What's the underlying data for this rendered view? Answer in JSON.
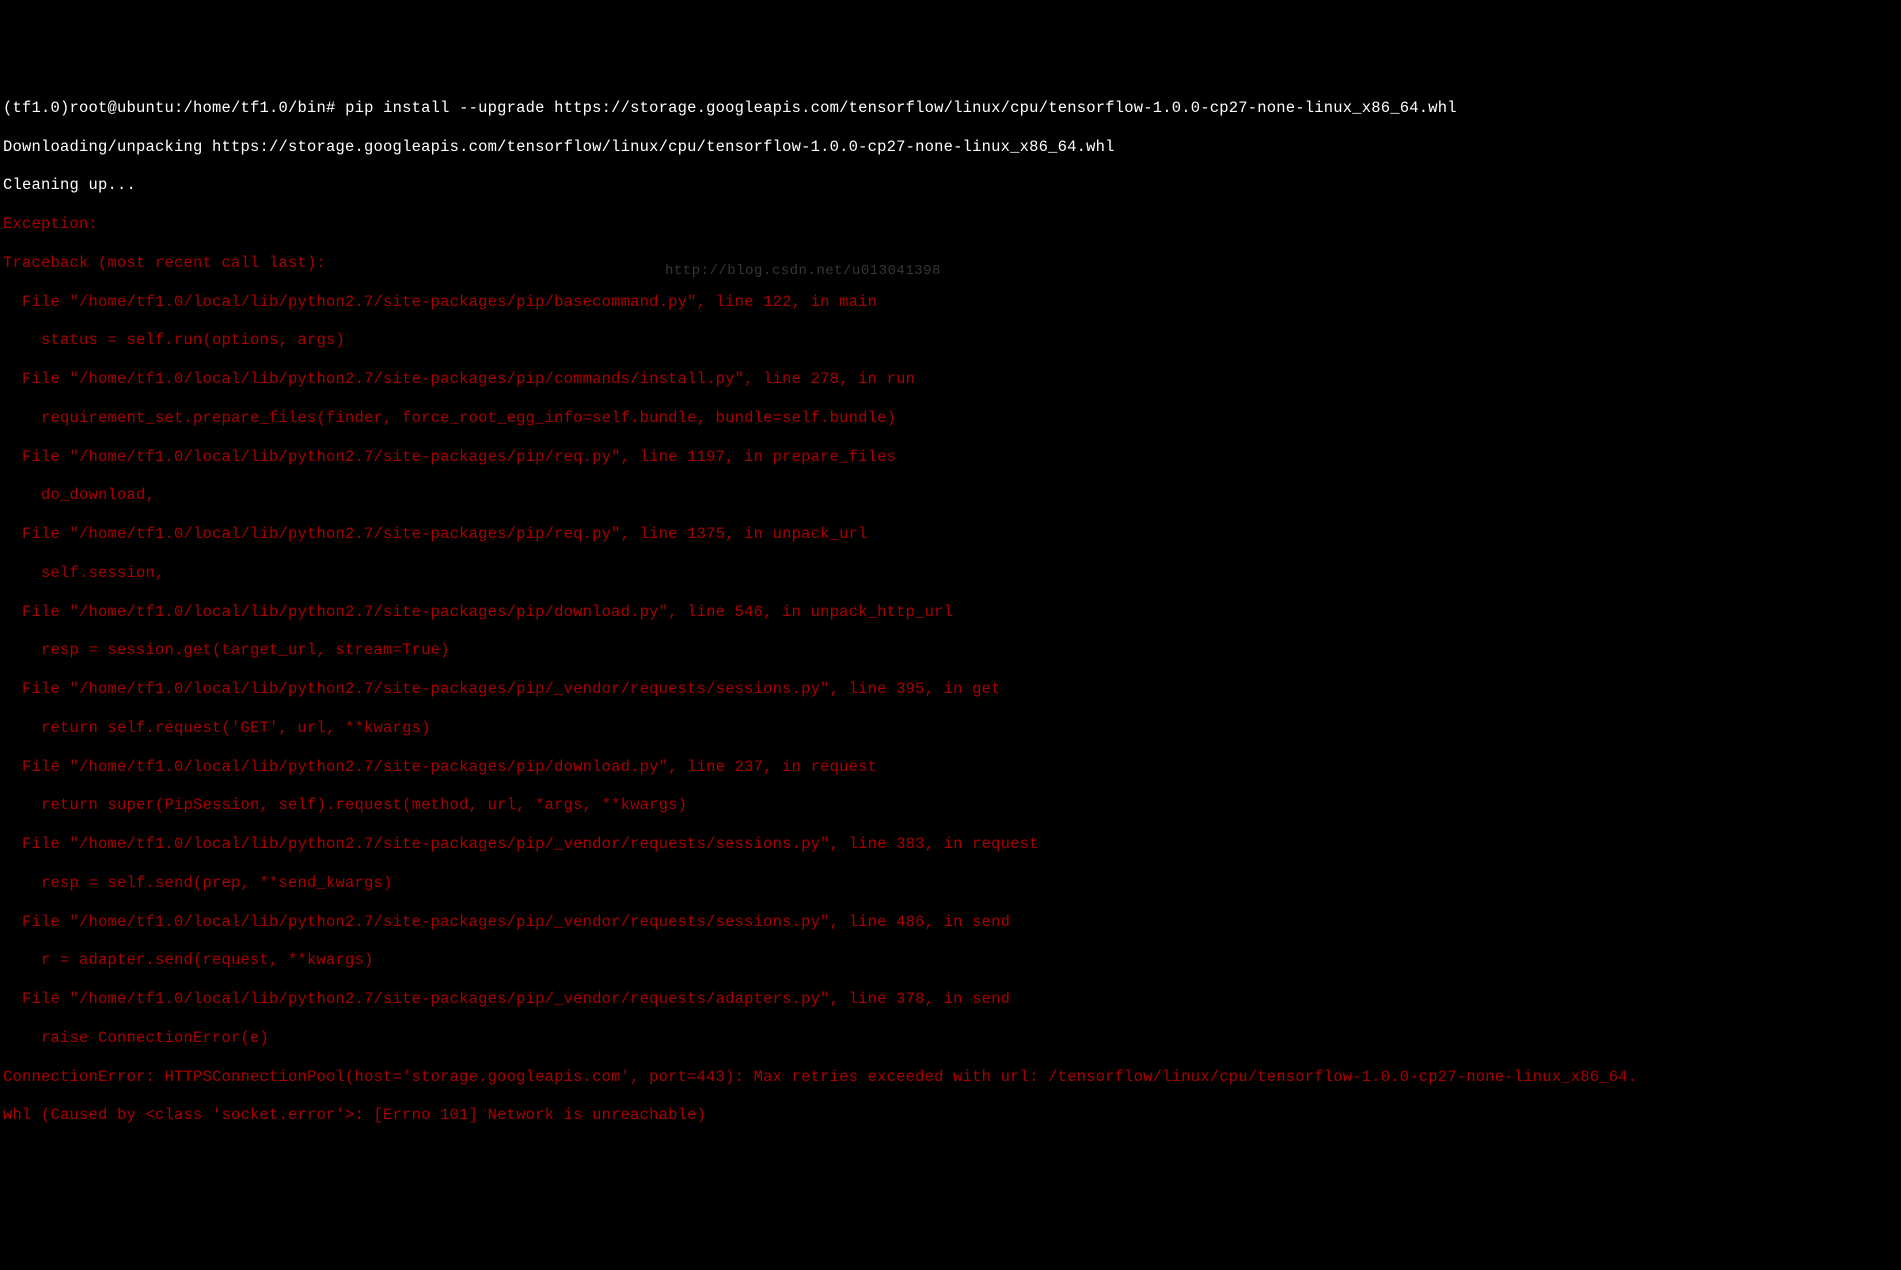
{
  "prompt": {
    "env": "(tf1.0)",
    "userhost": "root@ubuntu:/home/tf1.0/bin#",
    "command": "pip install --upgrade https://storage.googleapis.com/tensorflow/linux/cpu/tensorflow-1.0.0-cp27-none-linux_x86_64.whl"
  },
  "output": {
    "downloading": "Downloading/unpacking https://storage.googleapis.com/tensorflow/linux/cpu/tensorflow-1.0.0-cp27-none-linux_x86_64.whl",
    "cleaning": "Cleaning up..."
  },
  "error": {
    "exception": "Exception:",
    "traceback_header": "Traceback (most recent call last):",
    "frames": [
      {
        "file": "  File \"/home/tf1.0/local/lib/python2.7/site-packages/pip/basecommand.py\", line 122, in main",
        "code": "    status = self.run(options, args)"
      },
      {
        "file": "  File \"/home/tf1.0/local/lib/python2.7/site-packages/pip/commands/install.py\", line 278, in run",
        "code": "    requirement_set.prepare_files(finder, force_root_egg_info=self.bundle, bundle=self.bundle)"
      },
      {
        "file": "  File \"/home/tf1.0/local/lib/python2.7/site-packages/pip/req.py\", line 1197, in prepare_files",
        "code": "    do_download,"
      },
      {
        "file": "  File \"/home/tf1.0/local/lib/python2.7/site-packages/pip/req.py\", line 1375, in unpack_url",
        "code": "    self.session,"
      },
      {
        "file": "  File \"/home/tf1.0/local/lib/python2.7/site-packages/pip/download.py\", line 546, in unpack_http_url",
        "code": "    resp = session.get(target_url, stream=True)"
      },
      {
        "file": "  File \"/home/tf1.0/local/lib/python2.7/site-packages/pip/_vendor/requests/sessions.py\", line 395, in get",
        "code": "    return self.request('GET', url, **kwargs)"
      },
      {
        "file": "  File \"/home/tf1.0/local/lib/python2.7/site-packages/pip/download.py\", line 237, in request",
        "code": "    return super(PipSession, self).request(method, url, *args, **kwargs)"
      },
      {
        "file": "  File \"/home/tf1.0/local/lib/python2.7/site-packages/pip/_vendor/requests/sessions.py\", line 383, in request",
        "code": "    resp = self.send(prep, **send_kwargs)"
      },
      {
        "file": "  File \"/home/tf1.0/local/lib/python2.7/site-packages/pip/_vendor/requests/sessions.py\", line 486, in send",
        "code": "    r = adapter.send(request, **kwargs)"
      },
      {
        "file": "  File \"/home/tf1.0/local/lib/python2.7/site-packages/pip/_vendor/requests/adapters.py\", line 378, in send",
        "code": "    raise ConnectionError(e)"
      }
    ],
    "conn_error_line1": "ConnectionError: HTTPSConnectionPool(host='storage.googleapis.com', port=443): Max retries exceeded with url: /tensorflow/linux/cpu/tensorflow-1.0.0-cp27-none-linux_x86_64.",
    "conn_error_line2": "whl (Caused by <class 'socket.error'>: [Errno 101] Network is unreachable)"
  },
  "watermark": "http://blog.csdn.net/u013041398"
}
